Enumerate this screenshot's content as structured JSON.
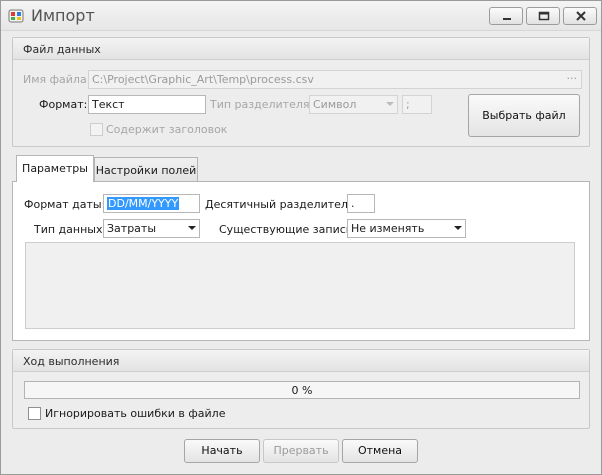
{
  "window": {
    "title": "Импорт",
    "controls": [
      "minimize-icon",
      "maximize-icon",
      "close-icon"
    ]
  },
  "file_group": {
    "header": "Файл данных",
    "filename_label": "Имя файла:",
    "filename_value": "C:\\Project\\Graphic_Art\\Temp\\process.csv",
    "browse_dots": "···",
    "format_label": "Формат:",
    "format_value": "Текст",
    "delimiter_type_label": "Тип разделителя:",
    "delimiter_type_value": "Символ",
    "delimiter_char": ";",
    "has_header_label": "Содержит заголовок",
    "has_header_checked": false,
    "choose_file_button": "Выбрать файл"
  },
  "tabs": [
    {
      "label": "Параметры",
      "active": true
    },
    {
      "label": "Настройки полей",
      "active": false
    }
  ],
  "params": {
    "date_format_label": "Формат даты:",
    "date_format_value": "DD/MM/YYYY",
    "decimal_sep_label": "Десятичный разделитель:",
    "decimal_sep_value": ".",
    "data_type_label": "Тип данных:",
    "data_type_value": "Затраты",
    "existing_records_label": "Существующие записи:",
    "existing_records_value": "Не изменять"
  },
  "progress_group": {
    "header": "Ход выполнения",
    "percent_text": "0 %",
    "progress": 0,
    "ignore_errors_label": "Игнорировать ошибки в файле",
    "ignore_errors_checked": false
  },
  "footer": {
    "start_button": "Начать",
    "abort_button": "Прервать",
    "cancel_button": "Отмена"
  },
  "colors": {
    "selection": "#3399ff",
    "disabled_text": "#a6a6a6"
  }
}
